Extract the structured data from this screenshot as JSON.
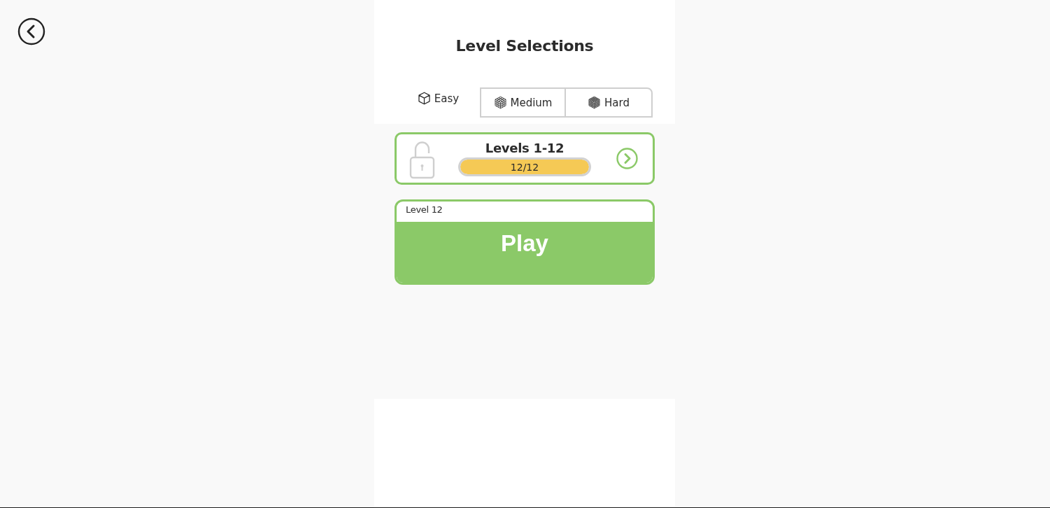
{
  "title": "Level Selections",
  "tabs": [
    {
      "label": "Easy",
      "selected": true
    },
    {
      "label": "Medium",
      "selected": false
    },
    {
      "label": "Hard",
      "selected": false
    }
  ],
  "level_group": {
    "title": "Levels 1-12",
    "locked": false,
    "progress": {
      "level": 1,
      "reading": "12/12"
    }
  },
  "current_level": {
    "label": "Level 12",
    "action": "Play"
  }
}
